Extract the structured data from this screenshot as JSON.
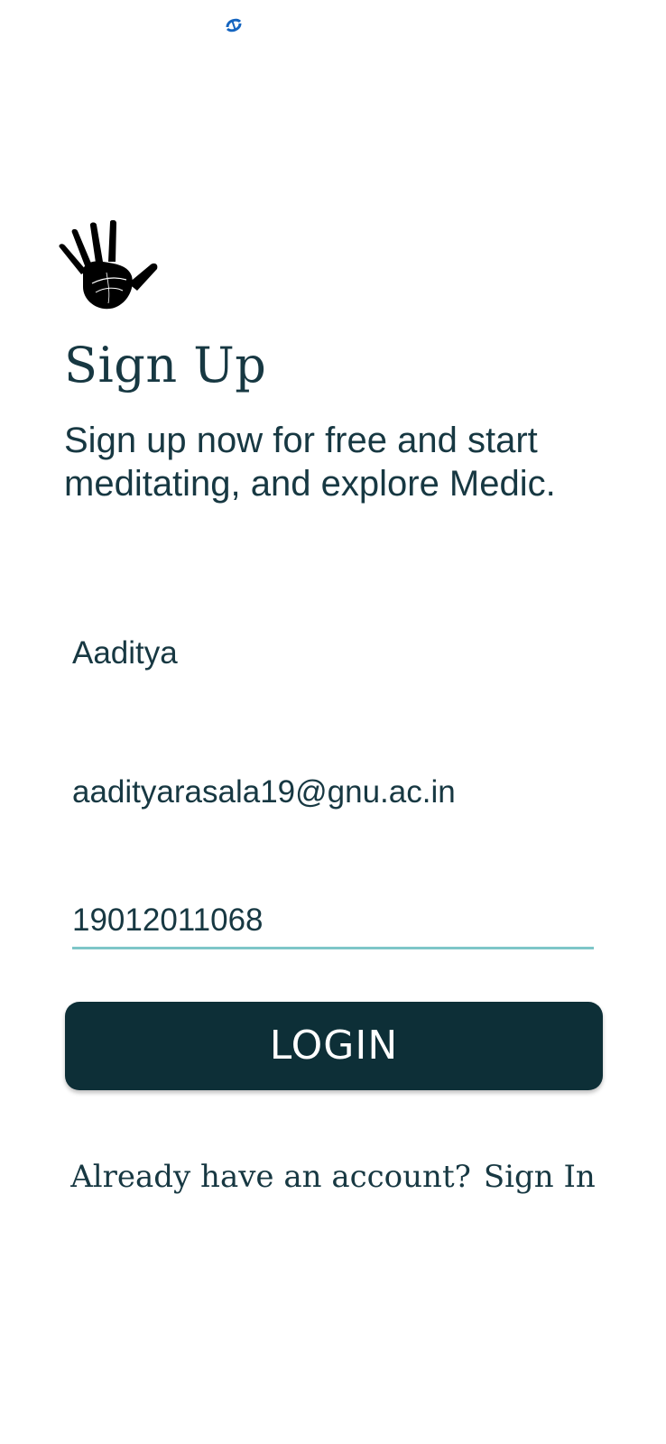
{
  "status_bar": {
    "icon": "sync-icon",
    "icon_color": "#1565C0"
  },
  "logo": {
    "icon": "hand-print-icon"
  },
  "title": "Sign Up",
  "subtitle": "Sign up now for free and start meditating, and explore Medic.",
  "form": {
    "name_value": "Aaditya",
    "email_value": "aadityarasala19@gnu.ac.in",
    "password_value": "19012011068"
  },
  "login_button_label": "LOGIN",
  "signin_prompt": {
    "text": "Already have an account?",
    "link_label": "Sign In"
  },
  "colors": {
    "primary": "#0d2f37",
    "accent_underline": "#7ec6c8",
    "text": "#173842"
  }
}
